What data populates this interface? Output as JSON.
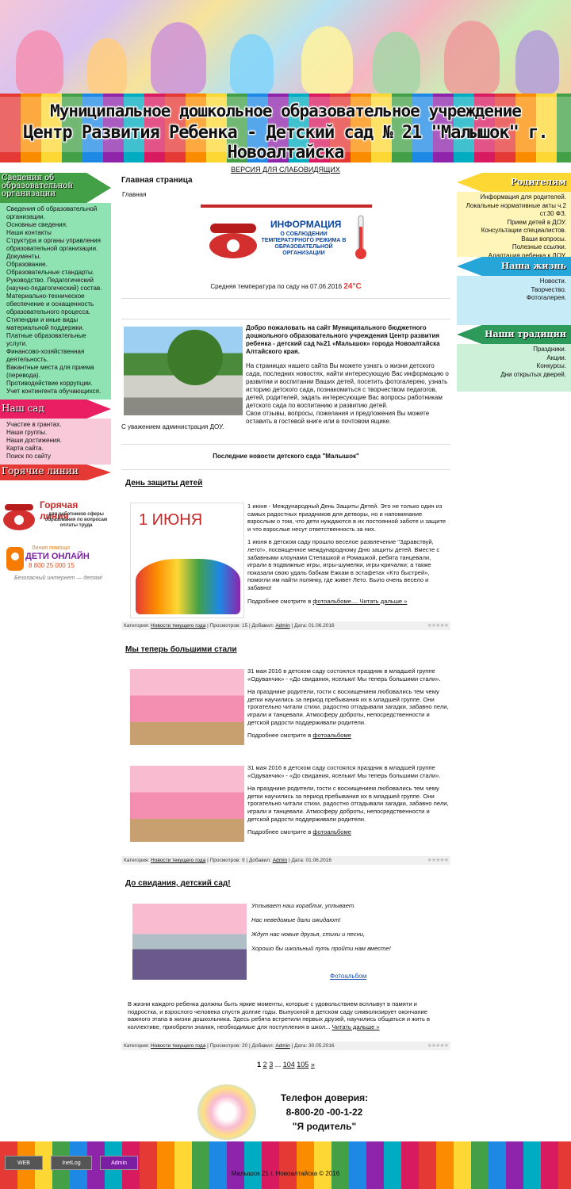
{
  "header": {
    "title_line1": "Муниципальное дошкольное образовательное учреждение",
    "title_line2": "Центр Развития Ребенка - Детский сад № 21 \"Малышок\" г. Новоалтайска"
  },
  "accessibility_link": "ВЕРСИЯ ДЛЯ СЛАБОВИДЯЩИХ",
  "left_sidebar": {
    "section1_title": "Сведения об образовательной организации",
    "section1_items": [
      "Сведения об образовательной организации.",
      "Основные сведения.",
      "Наши контакты",
      "Структура и органы управления образовательной организации.",
      "Документы.",
      "Образование.",
      "Образовательные стандарты.",
      "Руководство. Педагогический (научно-педагогический) состав.",
      "Материально-техническое обеспечение и оснащенность образовательного процесса.",
      "Стипендии и иные виды материальной поддержки.",
      "Платные образовательные услуги.",
      "Финансово-хозяйственная деятельность.",
      "Вакантные места для приема (перевода).",
      "Противодействие коррупции.",
      "Учет контингента обучающихся."
    ],
    "section2_title": "Наш сад",
    "section2_items": [
      "Участие в грантах.",
      "Наши группы.",
      "Наши достижения.",
      "Карта сайта.",
      "Поиск по сайту"
    ],
    "section3_title": "Горячие линии",
    "hotline_title": "Горячая линия",
    "hotline_sub": "для работников сферы образования по вопросам оплаты труда",
    "kids_line_top": "Линия помощи",
    "kids_line_name": "ДЕТИ ОНЛАЙН",
    "kids_line_phone": "8 800 25 000 15",
    "kids_line_slogan": "Безопасный интернет — детям!"
  },
  "right_sidebar": {
    "section1_title": "Родителям",
    "section1_items": [
      "Информация для родителей.",
      "Локальные нормативные акты ч.2 ст.30 ФЗ.",
      "Прием детей в ДОУ.",
      "Консультации специалистов.",
      "Ваши вопросы.",
      "Полезные ссылки.",
      "Адаптация ребенка к ДОУ."
    ],
    "section2_title": "Наша жизнь",
    "section2_items": [
      "Новости.",
      "Творчество.",
      "Фотогалерея."
    ],
    "section3_title": "Наши традиции",
    "section3_items": [
      "Праздники.",
      "Акции.",
      "Конкурсы.",
      "Дни открытых дверей."
    ]
  },
  "main": {
    "page_title": "Главная страница",
    "breadcrumb": "Главная",
    "temp_banner_title": "ИНФОРМАЦИЯ",
    "temp_banner_sub": "О СОБЛЮДЕНИИ ТЕМПЕРАТУРНОГО РЕЖИМА В ОБРАЗОВАТЕЛЬНОЙ ОРГАНИЗАЦИИ",
    "temp_text": "Средняя температура по саду на 07.06.2016",
    "temp_value": "24°C",
    "welcome_bold": "Добро пожаловать на сайт Муниципального бюджетного дошкольного образовательного учреждения Центр развития ребенка - детский сад №21 «Малышок» города Новоалтайска Алтайского края.",
    "welcome_p1": "На страницах нашего сайта Вы можете узнать о жизни детского сада, последних новостях, найти интересующую Вас информацию о развитии и воспитании Ваших детей, посетить фотогалерею, узнать историю детского сада, познакомиться с творчеством педагогов, детей, родителей, задать интересующие Вас вопросы работникам детского сада по воспитанию и развитию детей.",
    "welcome_p2": "Свои отзывы, вопросы, пожелания и предложения Вы можете оставить в гостевой книге или в почтовом ящике.",
    "signature": "С уважением администрация ДОУ.",
    "news_heading": "Последние новости детского сада \"Малышок\""
  },
  "news": [
    {
      "title": "День защиты детей",
      "image_caption": "1 ИЮНЯ",
      "p1": "1 июня - Международный День Защиты Детей. Это не только один из самых радостных праздников для детворы, но и напоминание взрослым о том, что дети нуждаются в их постоянной заботе и защите и что взрослые несут ответственность за них.",
      "p2": "1 июня в детском саду прошло веселое развлечение \"Здравствуй, лето!», посвященное международному Дню защиты детей. Вместе с забавными клоунами Степашкой и Ромашкой, ребята танцевали, играли в подвижные игры, игры-шумелки, игры-кричалки; а также показали свою удаль бабкам Ежкам в эстафетах «Кто быстрей», помогли им найти полянку, где живет Лето. Было очень весело и забавно!",
      "more_prefix": "Подробнее смотрите в",
      "more_link": "фотоальбоме.... Читать дальше »",
      "meta_category_label": "Категория:",
      "meta_category": "Новости текущего года",
      "meta_views": "| Просмотров: 15 | Добавил:",
      "meta_author": "Admin",
      "meta_date": "| Дата: 01.06.2016"
    },
    {
      "title": "Мы теперь большими стали",
      "p1": "31 мая 2016 в детском саду состоялся праздник в младшей группе «Одуванчик» - «До свидания, ясельки! Мы теперь большими стали».",
      "p2": "На празднике родители, гости с восхищением любовались тем чему детки научились за период пребывания их в младшей группе. Они трогательно читали стихи, радостно отгадывали загадки, забавно пели, играли и танцевали. Атмосферу доброты, непосредственности и детской радости поддерживали родители.",
      "more_prefix": "Подробнее смотрите в",
      "more_link": "фотоальбоме",
      "meta_category_label": "Категория:",
      "meta_category": "Новости текущего года",
      "meta_views": "| Просмотров: 9 | Добавил:",
      "meta_author": "Admin",
      "meta_date": "| Дата: 01.06.2016"
    },
    {
      "title": "До свидания, детский сад!",
      "poem": [
        "Уплывает наш кораблик, уплывает.",
        "Нас неведомые дали ожидают!",
        "Ждут нас новые друзья, стихи и песни,",
        "Хорошо бы школьный путь пройти нам вместе!"
      ],
      "album_link": "Фотоальбом",
      "body": "В жизни каждого ребенка должны быть яркие моменты, которые с удовольствием всплывут в памяти и подростка, и взрослого человека спустя долгие годы. Выпускной в детском саду символизирует окончание важного этапа в жизни дошкольника. Здесь ребята встретили первых друзей, научились общаться и жить в коллективе, приобрели знания, необходимые для поступления в школ...",
      "more_link": "Читать дальше »",
      "meta_category_label": "Категория:",
      "meta_category": "Новости текущего года",
      "meta_views": "| Просмотров: 20 | Добавил:",
      "meta_author": "Admin",
      "meta_date": "| Дата: 30.05.2016"
    }
  ],
  "pager": {
    "current": "1",
    "p2": "2",
    "p3": "3",
    "dots": "...",
    "p104": "104",
    "p105": "105",
    "next": "»"
  },
  "trust": {
    "line1": "Телефон доверия:",
    "line2": "8-800-20 -00-1-22",
    "line3": "\"Я родитель\""
  },
  "footer": {
    "counter1": "WEB",
    "counter2": "InetLog",
    "counter3": "Admin",
    "copyright": "Малышок 21 г. Новоалтайска © 2016"
  }
}
